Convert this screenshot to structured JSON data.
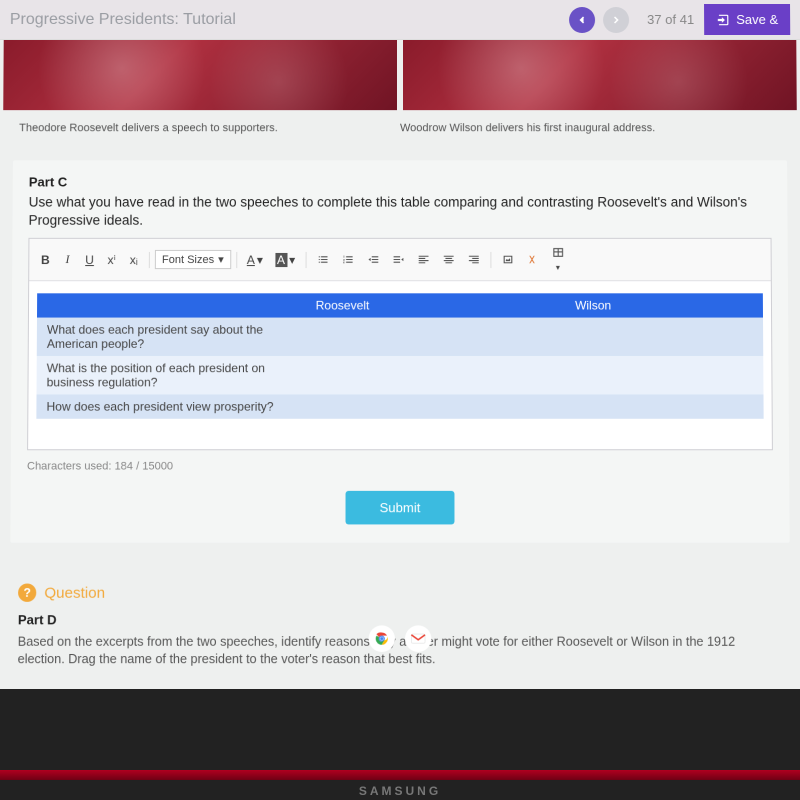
{
  "topbar": {
    "title": "Progressive Presidents: Tutorial",
    "page_current": "37",
    "page_of": "of",
    "page_total": "41",
    "save_label": "Save &"
  },
  "captions": {
    "left": "Theodore Roosevelt delivers a speech to supporters.",
    "right": "Woodrow Wilson delivers his first inaugural address."
  },
  "partC": {
    "label": "Part C",
    "prompt": "Use what you have read in the two speeches to complete this table comparing and contrasting Roosevelt's and Wilson's Progressive ideals.",
    "toolbar": {
      "bold": "B",
      "italic": "I",
      "underline": "U",
      "sup": "xⁱ",
      "sub": "xᵢ",
      "font_sizes": "Font Sizes",
      "a_text": "A",
      "a_bg": "A"
    },
    "table": {
      "headers": [
        "",
        "Roosevelt",
        "Wilson"
      ],
      "rows": [
        [
          "What does each president say about the American people?",
          "",
          ""
        ],
        [
          "What is the position of each president on business regulation?",
          "",
          ""
        ],
        [
          "How does each president view prosperity?",
          "",
          ""
        ]
      ]
    },
    "char_count": "Characters used: 184 / 15000",
    "submit": "Submit"
  },
  "question": {
    "badge": "?",
    "title": "Question"
  },
  "partD": {
    "label": "Part D",
    "prompt": "Based on the excerpts from the two speeches, identify reasons why a voter might vote for either Roosevelt or Wilson in the 1912 election. Drag the name of the president to the voter's reason that best fits."
  },
  "brand": "SAMSUNG"
}
